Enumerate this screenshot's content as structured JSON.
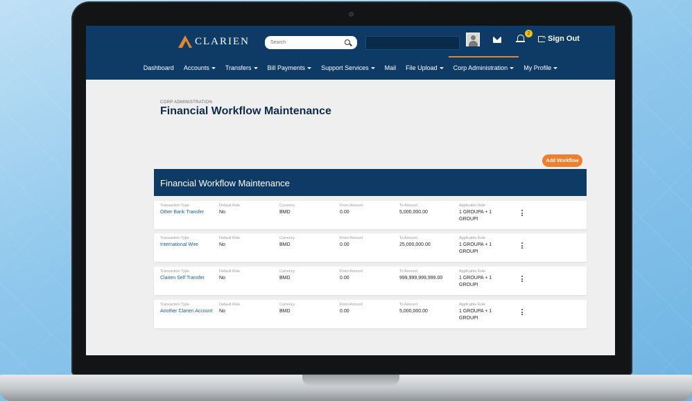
{
  "header": {
    "logo_text": "CLARIEN",
    "search_placeholder": "Search",
    "notification_count": "2",
    "sign_out_label": "Sign Out"
  },
  "nav": [
    {
      "label": "Dashboard",
      "dropdown": false
    },
    {
      "label": "Accounts",
      "dropdown": true
    },
    {
      "label": "Transfers",
      "dropdown": true
    },
    {
      "label": "Bill Payments",
      "dropdown": true
    },
    {
      "label": "Support Services",
      "dropdown": true
    },
    {
      "label": "Mail",
      "dropdown": false
    },
    {
      "label": "File Upload",
      "dropdown": true
    },
    {
      "label": "Corp Administration",
      "dropdown": true,
      "active": true
    },
    {
      "label": "My Profile",
      "dropdown": true
    }
  ],
  "page": {
    "breadcrumb": "CORP ADMINISTRATION",
    "title": "Financial Workflow Maintenance",
    "add_button": "Add Workflow",
    "table_title": "Financial Workflow Maintenance"
  },
  "columns": {
    "transaction_type": "Transaction Type",
    "default_rule": "Default Rule",
    "currency": "Currency",
    "from_amount": "From Amount",
    "to_amount": "To Amount",
    "applicable_rule": "Applicable Rule"
  },
  "rows": [
    {
      "transaction_type": "Other Bank Transfer",
      "default_rule": "No",
      "currency": "BMD",
      "from_amount": "0.00",
      "to_amount": "5,000,000.00",
      "applicable_rule": "1 GROUPA + 1 GROUPI"
    },
    {
      "transaction_type": "International Wire",
      "default_rule": "No",
      "currency": "BMD",
      "from_amount": "0.00",
      "to_amount": "25,000,000.00",
      "applicable_rule": "1 GROUPA + 1 GROUPI"
    },
    {
      "transaction_type": "Clarien Self Transfer",
      "default_rule": "No",
      "currency": "BMD",
      "from_amount": "0.00",
      "to_amount": "999,999,999,999.00",
      "applicable_rule": "1 GROUPA + 1 GROUPI"
    },
    {
      "transaction_type": "Another Clarien Account",
      "default_rule": "No",
      "currency": "BMD",
      "from_amount": "0.00",
      "to_amount": "5,000,000.00",
      "applicable_rule": "1 GROUPA + 1 GROUPI"
    }
  ],
  "colors": {
    "brand_navy": "#0d3b66",
    "accent_orange": "#ef7f2d",
    "link_blue": "#1a5a99"
  }
}
